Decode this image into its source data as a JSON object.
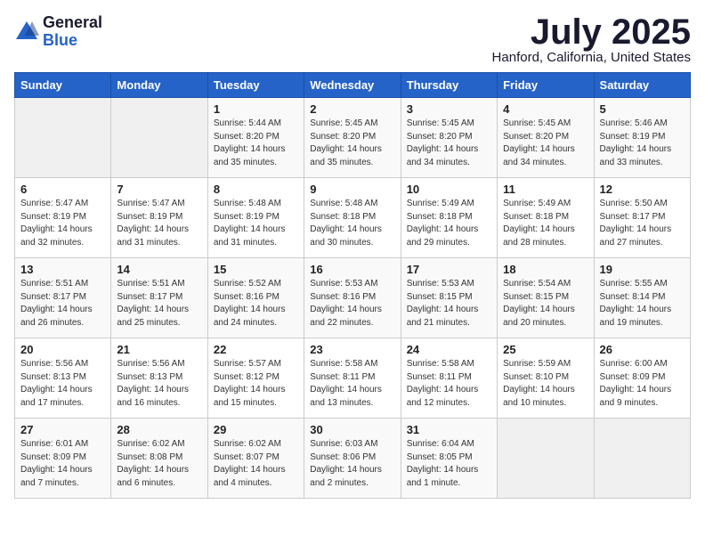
{
  "header": {
    "logo_line1": "General",
    "logo_line2": "Blue",
    "month_title": "July 2025",
    "location": "Hanford, California, United States"
  },
  "weekdays": [
    "Sunday",
    "Monday",
    "Tuesday",
    "Wednesday",
    "Thursday",
    "Friday",
    "Saturday"
  ],
  "weeks": [
    [
      {
        "num": "",
        "detail": ""
      },
      {
        "num": "",
        "detail": ""
      },
      {
        "num": "1",
        "detail": "Sunrise: 5:44 AM\nSunset: 8:20 PM\nDaylight: 14 hours and 35 minutes."
      },
      {
        "num": "2",
        "detail": "Sunrise: 5:45 AM\nSunset: 8:20 PM\nDaylight: 14 hours and 35 minutes."
      },
      {
        "num": "3",
        "detail": "Sunrise: 5:45 AM\nSunset: 8:20 PM\nDaylight: 14 hours and 34 minutes."
      },
      {
        "num": "4",
        "detail": "Sunrise: 5:45 AM\nSunset: 8:20 PM\nDaylight: 14 hours and 34 minutes."
      },
      {
        "num": "5",
        "detail": "Sunrise: 5:46 AM\nSunset: 8:19 PM\nDaylight: 14 hours and 33 minutes."
      }
    ],
    [
      {
        "num": "6",
        "detail": "Sunrise: 5:47 AM\nSunset: 8:19 PM\nDaylight: 14 hours and 32 minutes."
      },
      {
        "num": "7",
        "detail": "Sunrise: 5:47 AM\nSunset: 8:19 PM\nDaylight: 14 hours and 31 minutes."
      },
      {
        "num": "8",
        "detail": "Sunrise: 5:48 AM\nSunset: 8:19 PM\nDaylight: 14 hours and 31 minutes."
      },
      {
        "num": "9",
        "detail": "Sunrise: 5:48 AM\nSunset: 8:18 PM\nDaylight: 14 hours and 30 minutes."
      },
      {
        "num": "10",
        "detail": "Sunrise: 5:49 AM\nSunset: 8:18 PM\nDaylight: 14 hours and 29 minutes."
      },
      {
        "num": "11",
        "detail": "Sunrise: 5:49 AM\nSunset: 8:18 PM\nDaylight: 14 hours and 28 minutes."
      },
      {
        "num": "12",
        "detail": "Sunrise: 5:50 AM\nSunset: 8:17 PM\nDaylight: 14 hours and 27 minutes."
      }
    ],
    [
      {
        "num": "13",
        "detail": "Sunrise: 5:51 AM\nSunset: 8:17 PM\nDaylight: 14 hours and 26 minutes."
      },
      {
        "num": "14",
        "detail": "Sunrise: 5:51 AM\nSunset: 8:17 PM\nDaylight: 14 hours and 25 minutes."
      },
      {
        "num": "15",
        "detail": "Sunrise: 5:52 AM\nSunset: 8:16 PM\nDaylight: 14 hours and 24 minutes."
      },
      {
        "num": "16",
        "detail": "Sunrise: 5:53 AM\nSunset: 8:16 PM\nDaylight: 14 hours and 22 minutes."
      },
      {
        "num": "17",
        "detail": "Sunrise: 5:53 AM\nSunset: 8:15 PM\nDaylight: 14 hours and 21 minutes."
      },
      {
        "num": "18",
        "detail": "Sunrise: 5:54 AM\nSunset: 8:15 PM\nDaylight: 14 hours and 20 minutes."
      },
      {
        "num": "19",
        "detail": "Sunrise: 5:55 AM\nSunset: 8:14 PM\nDaylight: 14 hours and 19 minutes."
      }
    ],
    [
      {
        "num": "20",
        "detail": "Sunrise: 5:56 AM\nSunset: 8:13 PM\nDaylight: 14 hours and 17 minutes."
      },
      {
        "num": "21",
        "detail": "Sunrise: 5:56 AM\nSunset: 8:13 PM\nDaylight: 14 hours and 16 minutes."
      },
      {
        "num": "22",
        "detail": "Sunrise: 5:57 AM\nSunset: 8:12 PM\nDaylight: 14 hours and 15 minutes."
      },
      {
        "num": "23",
        "detail": "Sunrise: 5:58 AM\nSunset: 8:11 PM\nDaylight: 14 hours and 13 minutes."
      },
      {
        "num": "24",
        "detail": "Sunrise: 5:58 AM\nSunset: 8:11 PM\nDaylight: 14 hours and 12 minutes."
      },
      {
        "num": "25",
        "detail": "Sunrise: 5:59 AM\nSunset: 8:10 PM\nDaylight: 14 hours and 10 minutes."
      },
      {
        "num": "26",
        "detail": "Sunrise: 6:00 AM\nSunset: 8:09 PM\nDaylight: 14 hours and 9 minutes."
      }
    ],
    [
      {
        "num": "27",
        "detail": "Sunrise: 6:01 AM\nSunset: 8:09 PM\nDaylight: 14 hours and 7 minutes."
      },
      {
        "num": "28",
        "detail": "Sunrise: 6:02 AM\nSunset: 8:08 PM\nDaylight: 14 hours and 6 minutes."
      },
      {
        "num": "29",
        "detail": "Sunrise: 6:02 AM\nSunset: 8:07 PM\nDaylight: 14 hours and 4 minutes."
      },
      {
        "num": "30",
        "detail": "Sunrise: 6:03 AM\nSunset: 8:06 PM\nDaylight: 14 hours and 2 minutes."
      },
      {
        "num": "31",
        "detail": "Sunrise: 6:04 AM\nSunset: 8:05 PM\nDaylight: 14 hours and 1 minute."
      },
      {
        "num": "",
        "detail": ""
      },
      {
        "num": "",
        "detail": ""
      }
    ]
  ]
}
